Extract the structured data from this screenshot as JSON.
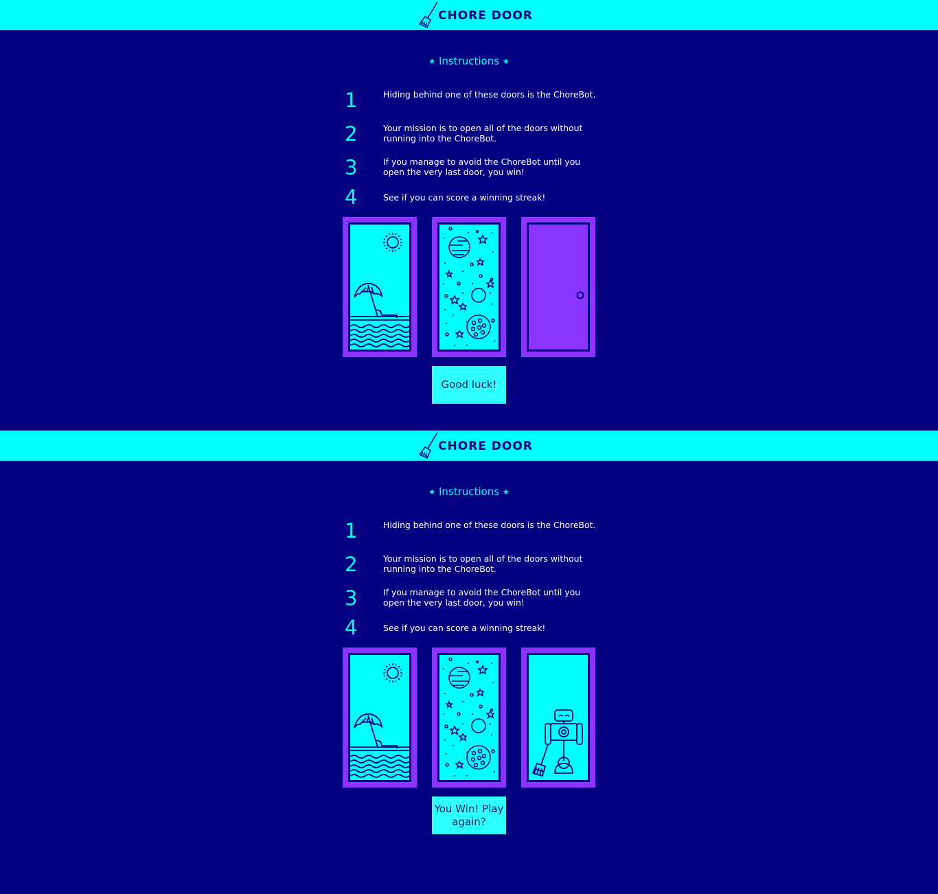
{
  "brand": {
    "title": "CHORE DOOR"
  },
  "instructions": {
    "title": "Instructions",
    "star": "★",
    "steps": [
      {
        "num": "1",
        "text": "Hiding behind one of these doors is the ChoreBot."
      },
      {
        "num": "2",
        "text": "Your mission is to open all of the doors without running into the ChoreBot."
      },
      {
        "num": "3",
        "text": "If you manage to avoid the ChoreBot until you open the very last door, you win!"
      },
      {
        "num": "4",
        "text": "See if you can score a winning streak!"
      }
    ]
  },
  "screens": [
    {
      "doors": [
        "beach",
        "space",
        "closed"
      ],
      "button": "Good luck!"
    },
    {
      "doors": [
        "beach",
        "space",
        "robot"
      ],
      "button": "You Win! Play again?"
    }
  ],
  "colors": {
    "background": "#010080",
    "header": "#00ffff",
    "door_frame": "#8c34ff",
    "accent": "#00ffff"
  }
}
